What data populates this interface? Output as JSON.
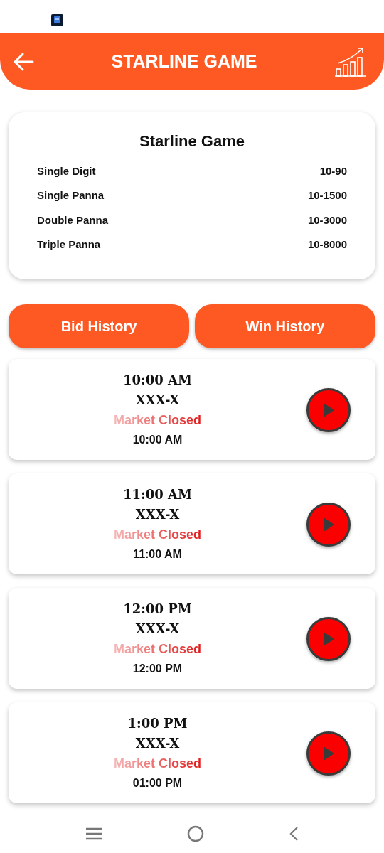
{
  "header": {
    "title": "STARLINE GAME"
  },
  "rates": {
    "title": "Starline Game",
    "rows": [
      {
        "name": "Single Digit",
        "range": "10-90"
      },
      {
        "name": "Single Panna",
        "range": "10-1500"
      },
      {
        "name": "Double Panna",
        "range": "10-3000"
      },
      {
        "name": "Triple Panna",
        "range": "10-8000"
      }
    ]
  },
  "buttons": [
    "Bid History",
    "Win History"
  ],
  "markets": [
    {
      "title": "10:00 AM",
      "result": "XXX-X",
      "status": "Market Closed",
      "time": "10:00 AM"
    },
    {
      "title": "11:00 AM",
      "result": "XXX-X",
      "status": "Market Closed",
      "time": "11:00 AM"
    },
    {
      "title": "12:00 PM",
      "result": "XXX-X",
      "status": "Market Closed",
      "time": "12:00 PM"
    },
    {
      "title": "1:00 PM",
      "result": "XXX-X",
      "status": "Market Closed",
      "time": "01:00 PM"
    }
  ]
}
